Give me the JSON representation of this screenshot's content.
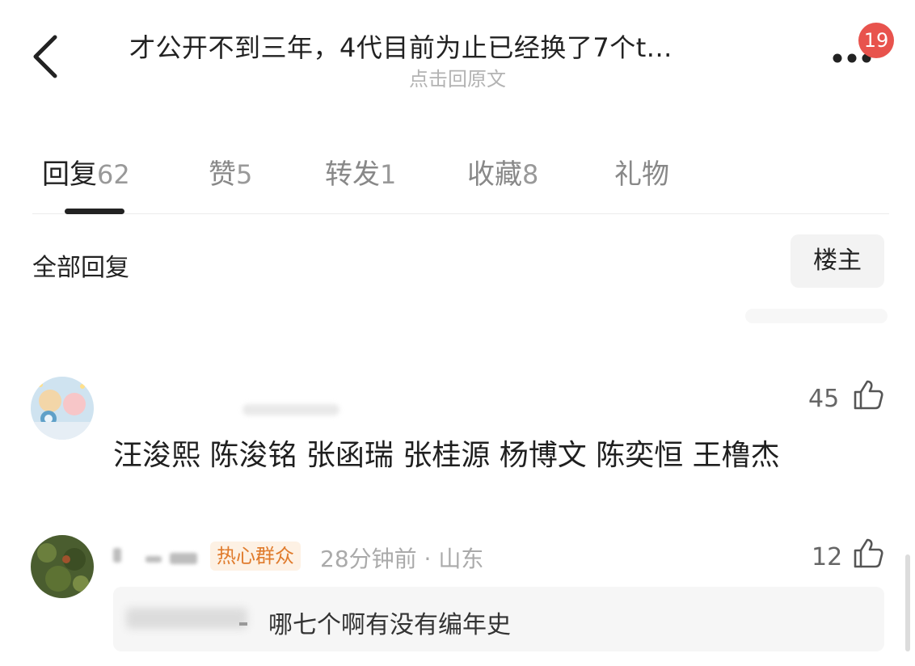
{
  "header": {
    "title": "才公开不到三年，4代目前为止已经换了7个t...",
    "subtitle": "点击回原文",
    "notification_count": "19"
  },
  "tabs": [
    {
      "label": "回复",
      "count": "62"
    },
    {
      "label": "赞",
      "count": "5"
    },
    {
      "label": "转发",
      "count": "1"
    },
    {
      "label": "收藏",
      "count": "8"
    },
    {
      "label": "礼物",
      "count": ""
    }
  ],
  "section": {
    "title": "全部回复",
    "filter_label": "楼主"
  },
  "comments": [
    {
      "likes": "45",
      "text": "汪浚熙 陈浚铭 张函瑞 张桂源 杨博文 陈奕恒 王橹杰"
    },
    {
      "tag": "热心群众",
      "meta": "28分钟前 · 山东",
      "likes": "12",
      "quote_text": "哪七个啊有没有编年史"
    }
  ],
  "icons": {
    "back": "chevron-left-icon",
    "more": "more-dots-icon",
    "like": "thumbs-up-icon"
  },
  "colors": {
    "badge": "#e8534d",
    "tag_bg": "#fdf1e4",
    "tag_text": "#e07b2c",
    "active_tab": "#222222",
    "inactive_tab": "#888888"
  }
}
